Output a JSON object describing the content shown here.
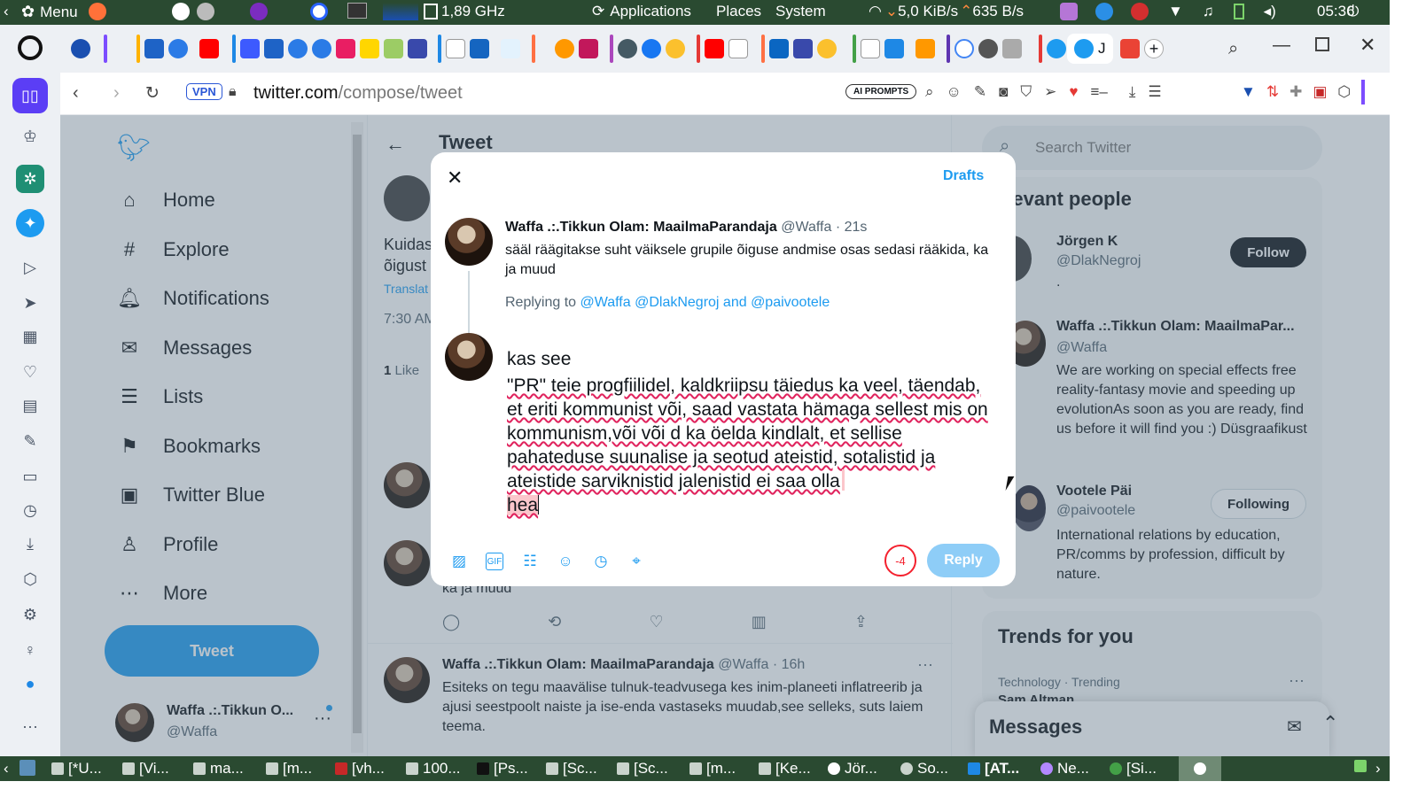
{
  "system_panel": {
    "menu_label": "Menu",
    "cpu_freq": "1,89 GHz",
    "applications": "Applications",
    "places": "Places",
    "system": "System",
    "net_down": "5,0 KiB/s",
    "net_up": "635 B/s",
    "clock": "05:36"
  },
  "browser": {
    "vpn_label": "VPN",
    "url_host": "twitter.com",
    "url_path": "/compose/tweet",
    "ai_prompts": "AI PROMPTS"
  },
  "twitter": {
    "nav": [
      {
        "label": "Home",
        "icon": "home-icon"
      },
      {
        "label": "Explore",
        "icon": "hashtag-icon"
      },
      {
        "label": "Notifications",
        "icon": "bell-icon"
      },
      {
        "label": "Messages",
        "icon": "envelope-icon"
      },
      {
        "label": "Lists",
        "icon": "list-icon"
      },
      {
        "label": "Bookmarks",
        "icon": "bookmark-icon"
      },
      {
        "label": "Twitter Blue",
        "icon": "twitter-blue-icon"
      },
      {
        "label": "Profile",
        "icon": "person-icon"
      },
      {
        "label": "More",
        "icon": "more-circle-icon"
      }
    ],
    "tweet_button": "Tweet",
    "account": {
      "name": "Waffa .:.Tikkun O...",
      "handle": "@Waffa"
    },
    "header_title": "Tweet",
    "bg": {
      "text_fragment_1": "Kuidas",
      "text_fragment_2": "õigust",
      "translate": "Translat",
      "time": "7:30 AM",
      "likes_count": "1",
      "likes_label": "Like",
      "reply_fragment": "ka ja muud",
      "tweet3": {
        "name": "Waffa .:.Tikkun Olam: MaailmaParandaja",
        "handle": "@Waffa",
        "time": "· 16h",
        "text": "Esiteks on tegu maavälise tulnuk-teadvusega kes inim-planeeti inflatreerib ja ajusi seestpoolt naiste ja ise-enda vastaseks muudab,see selleks, suts laiem teema."
      }
    },
    "search_placeholder": "Search Twitter",
    "relevant_title": "elevant people",
    "people": [
      {
        "name": "Jörgen K",
        "handle": "@DlakNegroj",
        "bio": ".",
        "button": "Follow"
      },
      {
        "name": "Waffa .:.Tikkun Olam: MaailmaPar...",
        "handle": "@Waffa",
        "bio": "We are working on special effects free reality-fantasy movie and speeding up evolutionAs soon as you are ready, find us before it will find you :) Düsgraafikust",
        "button": ""
      },
      {
        "name": "Vootele Päi",
        "handle": "@paivootele",
        "bio": "International relations by education, PR/comms by profession, difficult by nature.",
        "button": "Following"
      }
    ],
    "trends_title": "Trends for you",
    "trend_meta": "Technology · Trending",
    "trend_name": "Sam Altman",
    "messages_drawer": "Messages",
    "modal": {
      "drafts": "Drafts",
      "orig": {
        "name": "Waffa .:.Tikkun Olam: MaailmaParandaja",
        "handle": "@Waffa",
        "time": "· 21s",
        "text": "sääl räägitakse suht väiksele grupile õiguse andmise osas sedasi rääkida, ka ja muud"
      },
      "replying_to_label": "Replying to",
      "replying_to_handles": "@Waffa @DlakNegroj and @paivootele",
      "compose_line1": "kas see",
      "compose_line2": "\"PR\" teie progfiilidel, kaldkriipsu täiedus ka veel, täendab, et eriti kommunist või, saad vastata hämaga sellest mis on kommunism,või või d ka öelda kindlalt, et sellise pahateduse suunalise ja seotud ateistid, sotalistid ja ateistide sarviknistid jalenistid ei saa olla",
      "compose_overflow": "hea",
      "char_count": "-4",
      "reply_button": "Reply"
    }
  },
  "taskbar": [
    "[*U...",
    "[Vi...",
    "ma...",
    "[m...",
    "[vh...",
    "100...",
    "[Ps...",
    "[Sc...",
    "[Sc...",
    "[m...",
    "[Ke...",
    "Jör...",
    "So...",
    "[ΑΤ...",
    "Ne...",
    "[Si..."
  ],
  "colors": {
    "accent": "#1d9bf0",
    "panel": "#2a4a31",
    "error": "#f4212e"
  }
}
